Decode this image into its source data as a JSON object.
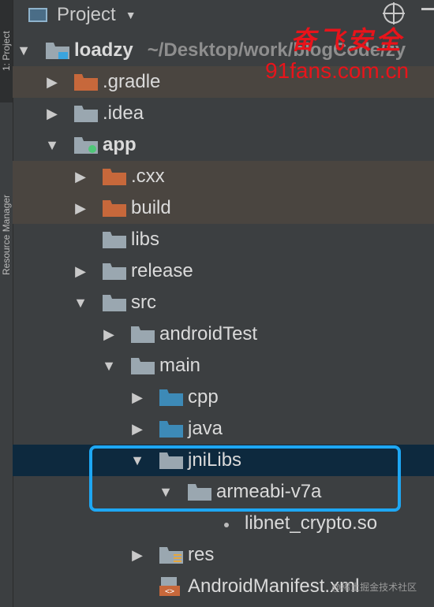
{
  "side_tabs": {
    "project": "1: Project",
    "resource_manager": "Resource Manager"
  },
  "header": {
    "title": "Project"
  },
  "tree": {
    "root": {
      "label": "loadzy",
      "path": "~/Desktop/work/blogCode/zy"
    },
    "gradle": ".gradle",
    "idea": ".idea",
    "app": "app",
    "cxx": ".cxx",
    "build": "build",
    "libs": "libs",
    "release": "release",
    "src": "src",
    "androidTest": "androidTest",
    "main": "main",
    "cpp": "cpp",
    "java": "java",
    "jniLibs": "jniLibs",
    "armeabi": "armeabi-v7a",
    "so_file": "libnet_crypto.so",
    "res": "res",
    "manifest": "AndroidManifest.xml"
  },
  "watermark": {
    "chinese": "奋飞安全",
    "url": "91fans.com.cn",
    "footer": "@稀土掘金技术社区"
  },
  "colors": {
    "excluded_folder": "#c7683b",
    "source_folder": "#3d8ab7",
    "folder": "#9aa7b0",
    "highlight": "#1ea7f3"
  }
}
